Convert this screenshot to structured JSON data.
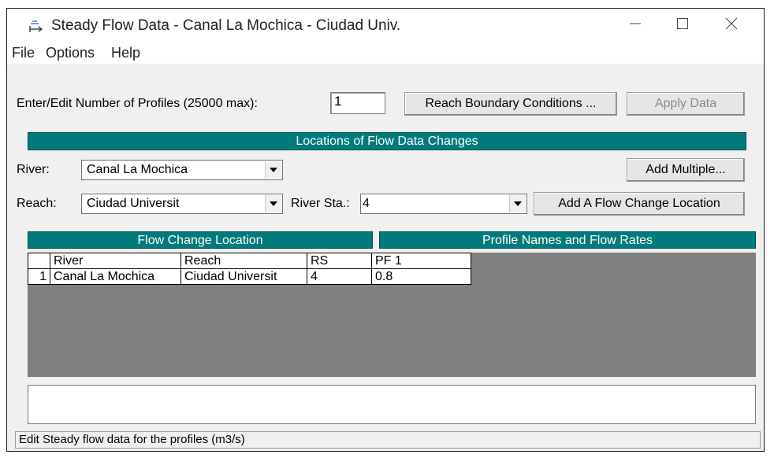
{
  "window": {
    "title": "Steady Flow Data - Canal La Mochica - Ciudad Univ."
  },
  "menu": [
    "File",
    "Options",
    "Help"
  ],
  "profiles": {
    "label": "Enter/Edit Number of Profiles (25000 max):",
    "value": "1"
  },
  "buttons": {
    "reach_boundary": "Reach Boundary Conditions ...",
    "apply_data": "Apply Data",
    "add_multiple": "Add Multiple...",
    "add_flow_change": "Add A Flow Change Location"
  },
  "locations_header": "Locations of Flow Data Changes",
  "river": {
    "label": "River:",
    "value": "Canal La Mochica"
  },
  "reach": {
    "label": "Reach:",
    "value": "Ciudad Universit"
  },
  "river_sta": {
    "label": "River Sta.:",
    "value": "4"
  },
  "flow_change_header": "Flow Change Location",
  "profile_names_header": "Profile Names and Flow Rates",
  "table": {
    "columns": [
      "",
      "River",
      "Reach",
      "RS",
      "PF 1"
    ],
    "rows": [
      [
        "1",
        "Canal La Mochica",
        "Ciudad Universit",
        "4",
        "0.8"
      ]
    ]
  },
  "status": "Edit Steady flow data for the profiles (m3/s)",
  "colors": {
    "teal_header": "#007b7b",
    "grid_background": "#808080"
  }
}
